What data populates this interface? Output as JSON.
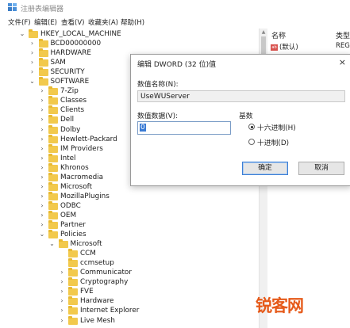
{
  "window": {
    "title": "注册表编辑器"
  },
  "menu": [
    "文件(F)",
    "编辑(E)",
    "查看(V)",
    "收藏夹(A)",
    "帮助(H)"
  ],
  "tree": [
    {
      "label": "HKEY_LOCAL_MACHINE",
      "expanded": true,
      "level": 0
    },
    {
      "label": "BCD00000000",
      "expanded": false,
      "level": 1
    },
    {
      "label": "HARDWARE",
      "expanded": false,
      "level": 1
    },
    {
      "label": "SAM",
      "expanded": false,
      "level": 1
    },
    {
      "label": "SECURITY",
      "expanded": false,
      "level": 1
    },
    {
      "label": "SOFTWARE",
      "expanded": true,
      "level": 1
    },
    {
      "label": "7-Zip",
      "expanded": false,
      "level": 2
    },
    {
      "label": "Classes",
      "expanded": false,
      "level": 2
    },
    {
      "label": "Clients",
      "expanded": false,
      "level": 2
    },
    {
      "label": "Dell",
      "expanded": false,
      "level": 2
    },
    {
      "label": "Dolby",
      "expanded": false,
      "level": 2
    },
    {
      "label": "Hewlett-Packard",
      "expanded": false,
      "level": 2
    },
    {
      "label": "IM Providers",
      "expanded": false,
      "level": 2
    },
    {
      "label": "Intel",
      "expanded": false,
      "level": 2
    },
    {
      "label": "Khronos",
      "expanded": false,
      "level": 2
    },
    {
      "label": "Macromedia",
      "expanded": false,
      "level": 2
    },
    {
      "label": "Microsoft",
      "expanded": false,
      "level": 2
    },
    {
      "label": "MozillaPlugins",
      "expanded": false,
      "level": 2
    },
    {
      "label": "ODBC",
      "expanded": false,
      "level": 2
    },
    {
      "label": "OEM",
      "expanded": false,
      "level": 2
    },
    {
      "label": "Partner",
      "expanded": false,
      "level": 2
    },
    {
      "label": "Policies",
      "expanded": true,
      "level": 2
    },
    {
      "label": "Microsoft",
      "expanded": true,
      "level": 3
    },
    {
      "label": "CCM",
      "expanded": null,
      "level": 4
    },
    {
      "label": "ccmsetup",
      "expanded": null,
      "level": 4
    },
    {
      "label": "Communicator",
      "expanded": false,
      "level": 4
    },
    {
      "label": "Cryptography",
      "expanded": false,
      "level": 4
    },
    {
      "label": "FVE",
      "expanded": false,
      "level": 4
    },
    {
      "label": "Hardware",
      "expanded": false,
      "level": 4
    },
    {
      "label": "Internet Explorer",
      "expanded": false,
      "level": 4
    },
    {
      "label": "Live Mesh",
      "expanded": false,
      "level": 4
    }
  ],
  "right_pane": {
    "columns": [
      "名称",
      "类型"
    ],
    "rows": [
      {
        "name": "(默认)",
        "type": "REG"
      }
    ]
  },
  "dialog": {
    "title": "编辑 DWORD (32 位)值",
    "close": "×",
    "name_label": "数值名称(N):",
    "name_value": "UseWUServer",
    "data_label": "数值数据(V):",
    "data_value": "0",
    "base_label": "基数",
    "hex_label": "十六进制(H)",
    "dec_label": "十进制(D)",
    "hex_selected": true,
    "ok": "确定",
    "cancel": "取消"
  },
  "watermark": "锐客网",
  "colors": {
    "folder": "#f2c94c",
    "accent": "#3a7bd5",
    "watermark": "#e65a1a"
  }
}
